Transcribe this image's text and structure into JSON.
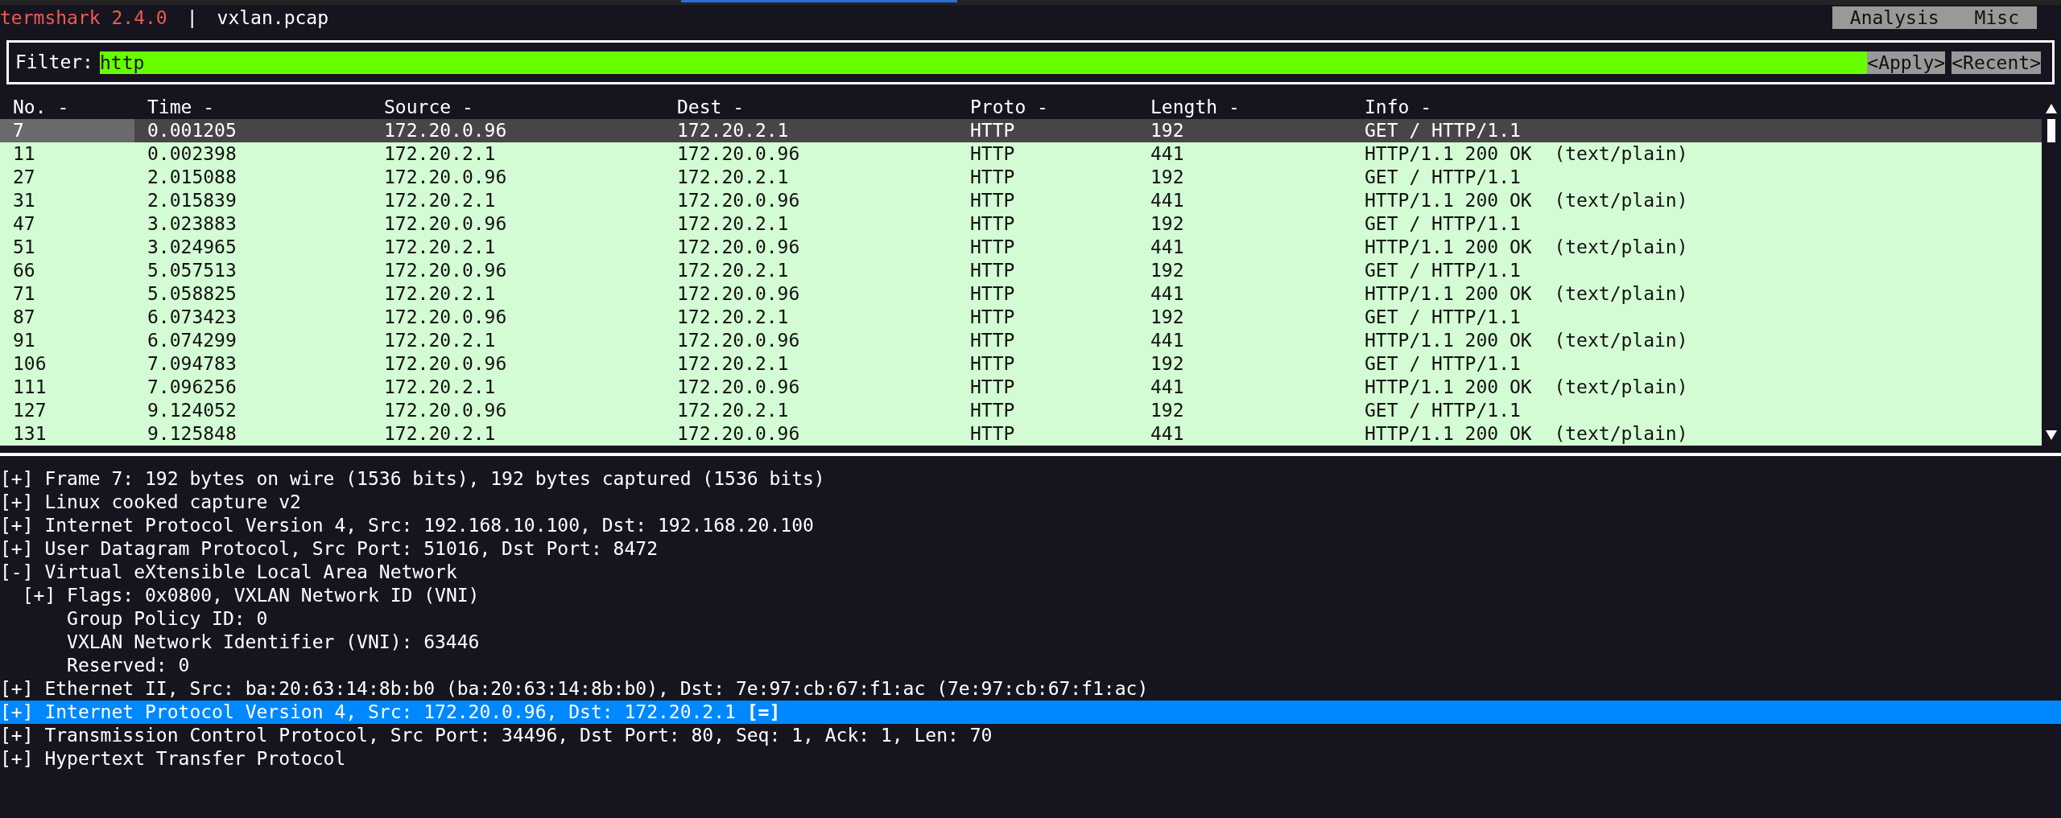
{
  "title_bar": {
    "app": "termshark 2.4.0",
    "separator": "|",
    "file": "vxlan.pcap"
  },
  "menu": [
    {
      "label": "Analysis"
    },
    {
      "label": "Misc"
    }
  ],
  "filter": {
    "label": "Filter:",
    "value": "http",
    "buttons": [
      "<Apply>",
      "<Recent>"
    ]
  },
  "table": {
    "columns": [
      "No. -",
      "Time -",
      "Source -",
      "Dest -",
      "Proto -",
      "Length -",
      "Info -"
    ],
    "rows": [
      {
        "cells": [
          "7",
          "0.001205",
          "172.20.0.96",
          "172.20.2.1",
          "HTTP",
          "192",
          "GET / HTTP/1.1"
        ],
        "selected": true
      },
      {
        "cells": [
          "11",
          "0.002398",
          "172.20.2.1",
          "172.20.0.96",
          "HTTP",
          "441",
          "HTTP/1.1 200 OK  (text/plain)"
        ],
        "selected": false
      },
      {
        "cells": [
          "27",
          "2.015088",
          "172.20.0.96",
          "172.20.2.1",
          "HTTP",
          "192",
          "GET / HTTP/1.1"
        ],
        "selected": false
      },
      {
        "cells": [
          "31",
          "2.015839",
          "172.20.2.1",
          "172.20.0.96",
          "HTTP",
          "441",
          "HTTP/1.1 200 OK  (text/plain)"
        ],
        "selected": false
      },
      {
        "cells": [
          "47",
          "3.023883",
          "172.20.0.96",
          "172.20.2.1",
          "HTTP",
          "192",
          "GET / HTTP/1.1"
        ],
        "selected": false
      },
      {
        "cells": [
          "51",
          "3.024965",
          "172.20.2.1",
          "172.20.0.96",
          "HTTP",
          "441",
          "HTTP/1.1 200 OK  (text/plain)"
        ],
        "selected": false
      },
      {
        "cells": [
          "66",
          "5.057513",
          "172.20.0.96",
          "172.20.2.1",
          "HTTP",
          "192",
          "GET / HTTP/1.1"
        ],
        "selected": false
      },
      {
        "cells": [
          "71",
          "5.058825",
          "172.20.2.1",
          "172.20.0.96",
          "HTTP",
          "441",
          "HTTP/1.1 200 OK  (text/plain)"
        ],
        "selected": false
      },
      {
        "cells": [
          "87",
          "6.073423",
          "172.20.0.96",
          "172.20.2.1",
          "HTTP",
          "192",
          "GET / HTTP/1.1"
        ],
        "selected": false
      },
      {
        "cells": [
          "91",
          "6.074299",
          "172.20.2.1",
          "172.20.0.96",
          "HTTP",
          "441",
          "HTTP/1.1 200 OK  (text/plain)"
        ],
        "selected": false
      },
      {
        "cells": [
          "106",
          "7.094783",
          "172.20.0.96",
          "172.20.2.1",
          "HTTP",
          "192",
          "GET / HTTP/1.1"
        ],
        "selected": false
      },
      {
        "cells": [
          "111",
          "7.096256",
          "172.20.2.1",
          "172.20.0.96",
          "HTTP",
          "441",
          "HTTP/1.1 200 OK  (text/plain)"
        ],
        "selected": false
      },
      {
        "cells": [
          "127",
          "9.124052",
          "172.20.0.96",
          "172.20.2.1",
          "HTTP",
          "192",
          "GET / HTTP/1.1"
        ],
        "selected": false
      },
      {
        "cells": [
          "131",
          "9.125848",
          "172.20.2.1",
          "172.20.0.96",
          "HTTP",
          "441",
          "HTTP/1.1 200 OK  (text/plain)"
        ],
        "selected": false
      }
    ]
  },
  "details": [
    {
      "marker": "[+]",
      "text": "Frame 7: 192 bytes on wire (1536 bits), 192 bytes captured (1536 bits)",
      "selected": false
    },
    {
      "marker": "[+]",
      "text": "Linux cooked capture v2",
      "selected": false
    },
    {
      "marker": "[+]",
      "text": "Internet Protocol Version 4, Src: 192.168.10.100, Dst: 192.168.20.100",
      "selected": false
    },
    {
      "marker": "[+]",
      "text": "User Datagram Protocol, Src Port: 51016, Dst Port: 8472",
      "selected": false
    },
    {
      "marker": "[-]",
      "text": "Virtual eXtensible Local Area Network",
      "selected": false,
      "children": [
        {
          "marker": "[+]",
          "text": "Flags: 0x0800, VXLAN Network ID (VNI)",
          "selected": false
        },
        {
          "text": "Group Policy ID: 0",
          "selected": false
        },
        {
          "text": "VXLAN Network Identifier (VNI): 63446",
          "selected": false
        },
        {
          "text": "Reserved: 0",
          "selected": false
        }
      ]
    },
    {
      "marker": "[+]",
      "text": "Ethernet II, Src: ba:20:63:14:8b:b0 (ba:20:63:14:8b:b0), Dst: 7e:97:cb:67:f1:ac (7e:97:cb:67:f1:ac)",
      "selected": false
    },
    {
      "marker": "[+]",
      "text": "Internet Protocol Version 4, Src: 172.20.0.96, Dst: 172.20.2.1 **[=]**",
      "selected": true
    },
    {
      "marker": "[+]",
      "text": "Transmission Control Protocol, Src Port: 34496, Dst Port: 80, Seq: 1, Ack: 1, Len: 70",
      "selected": false
    },
    {
      "marker": "[+]",
      "text": "Hypertext Transfer Protocol",
      "selected": false
    }
  ]
}
